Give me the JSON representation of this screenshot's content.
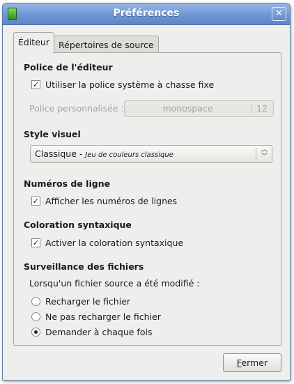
{
  "window": {
    "title": "Préférences"
  },
  "tabs": [
    {
      "label": "Éditeur",
      "active": true
    },
    {
      "label": "Répertoires de source",
      "active": false
    }
  ],
  "font_section": {
    "title": "Police de l'éditeur",
    "use_system_font": {
      "label": "Utiliser la police système à chasse fixe",
      "checked": true
    },
    "custom_font_label": "Police personnalisée :",
    "font_name": "monospace",
    "font_size": "12"
  },
  "style_section": {
    "title": "Style visuel",
    "scheme_name": "Classique",
    "scheme_separator": " - ",
    "scheme_description": "Jeu de couleurs classique"
  },
  "line_numbers_section": {
    "title": "Numéros de ligne",
    "show_line_numbers": {
      "label": "Afficher les numéros de lignes",
      "checked": true
    }
  },
  "syntax_section": {
    "title": "Coloration syntaxique",
    "enable_syntax": {
      "label": "Activer la coloration syntaxique",
      "checked": true
    }
  },
  "monitor_section": {
    "title": "Surveillance des fichiers",
    "description": "Lorsqu'un fichier source a été modifié :",
    "options": [
      {
        "label": "Recharger le fichier",
        "selected": false
      },
      {
        "label": "Ne pas recharger le fichier",
        "selected": false
      },
      {
        "label": "Demander à chaque fois",
        "selected": true
      }
    ]
  },
  "footer": {
    "close_label_mnemonic": "F",
    "close_label_rest": "ermer"
  },
  "icons": {
    "app": "app-icon",
    "close": "close-icon",
    "combo": "updown-arrows-icon",
    "check": "checkmark-icon"
  },
  "colors": {
    "titlebar": "#6f96d4",
    "window_bg": "#eeeeec",
    "border": "#a7a8a4"
  }
}
